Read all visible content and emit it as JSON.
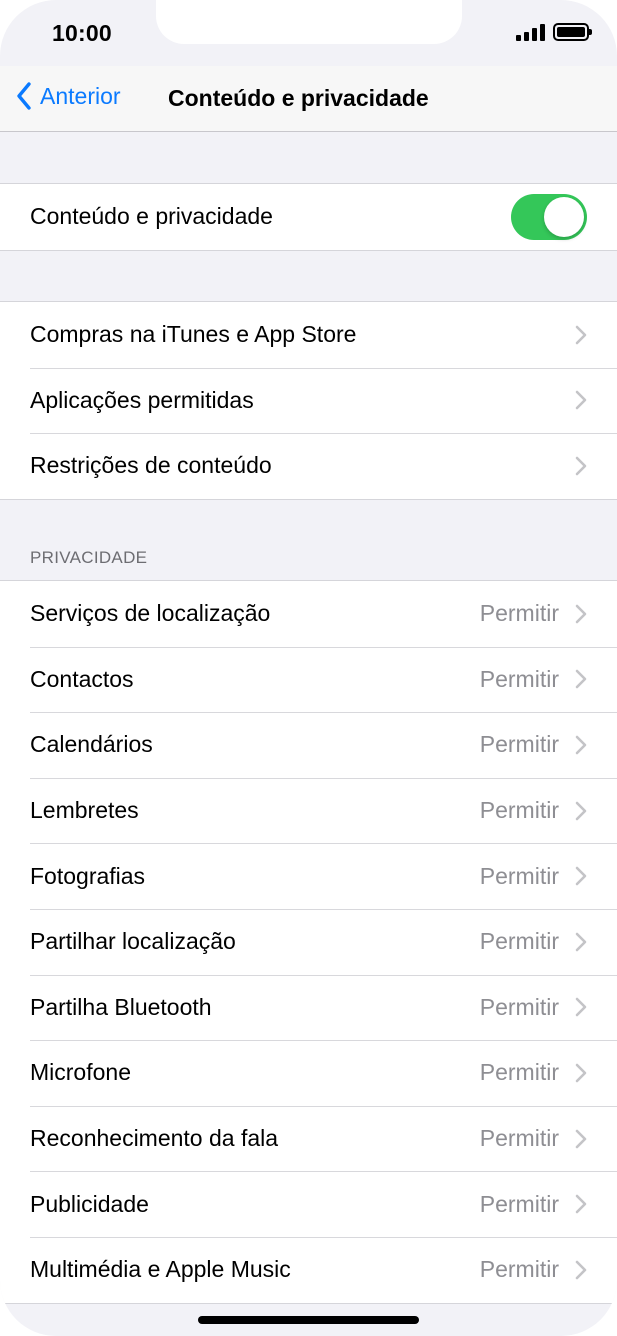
{
  "status_bar": {
    "time": "10:00"
  },
  "nav": {
    "back_label": "Anterior",
    "title": "Conteúdo e privacidade"
  },
  "master_toggle": {
    "label": "Conteúdo e privacidade",
    "on": true
  },
  "restrictions": [
    {
      "label": "Compras na iTunes e App Store"
    },
    {
      "label": "Aplicações permitidas"
    },
    {
      "label": "Restrições de conteúdo"
    }
  ],
  "privacy": {
    "header": "PRIVACIDADE",
    "items": [
      {
        "label": "Serviços de localização",
        "value": "Permitir"
      },
      {
        "label": "Contactos",
        "value": "Permitir"
      },
      {
        "label": "Calendários",
        "value": "Permitir"
      },
      {
        "label": "Lembretes",
        "value": "Permitir"
      },
      {
        "label": "Fotografias",
        "value": "Permitir"
      },
      {
        "label": "Partilhar localização",
        "value": "Permitir"
      },
      {
        "label": "Partilha Bluetooth",
        "value": "Permitir"
      },
      {
        "label": "Microfone",
        "value": "Permitir"
      },
      {
        "label": "Reconhecimento da fala",
        "value": "Permitir"
      },
      {
        "label": "Publicidade",
        "value": "Permitir"
      },
      {
        "label": "Multimédia e Apple Music",
        "value": "Permitir"
      }
    ]
  },
  "colors": {
    "accent": "#0a7aff",
    "toggle_on": "#34c759",
    "secondary_text": "#8e8e93"
  },
  "icons": [
    "signal-icon",
    "battery-icon",
    "back-chevron-icon",
    "chevron-right-icon"
  ]
}
